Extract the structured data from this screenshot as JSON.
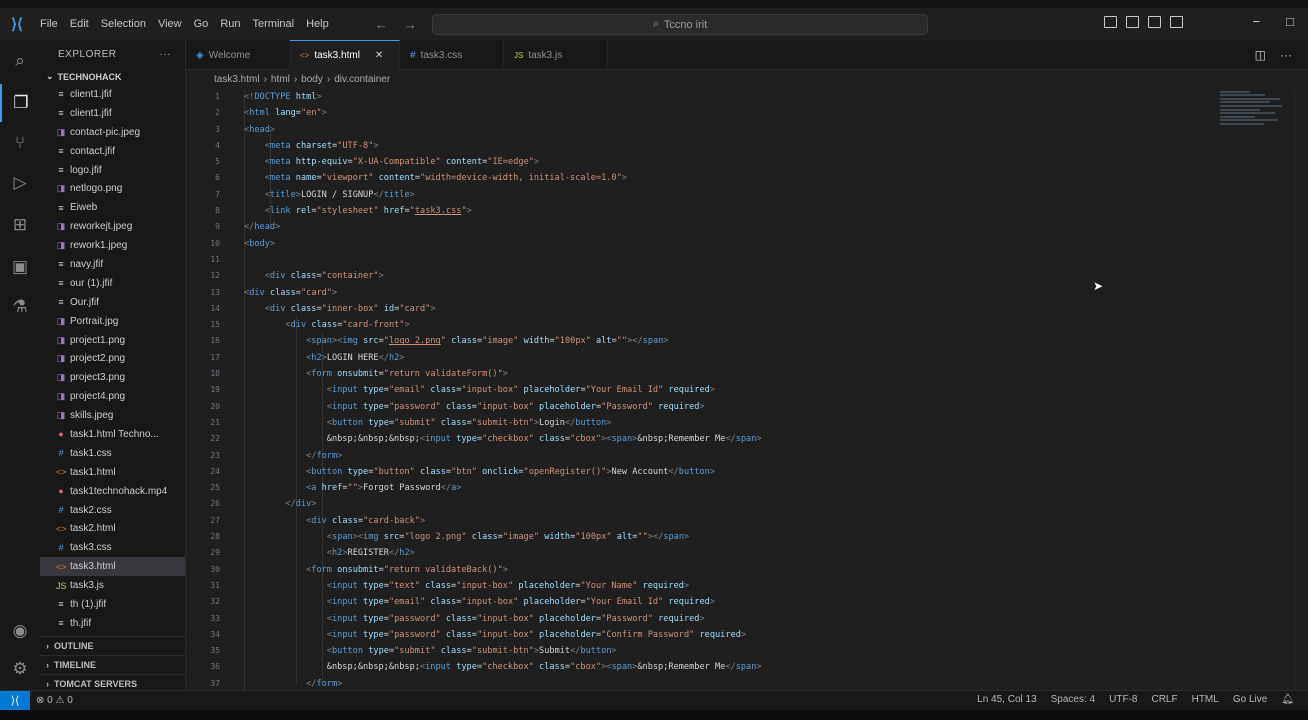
{
  "colors": {
    "accent": "#3b9bea",
    "tag": "#569cd6",
    "attr": "#9cdcfe",
    "string": "#ce9178",
    "remote_bg": "#0078d4"
  },
  "titlebar": {
    "menu": [
      "File",
      "Edit",
      "Selection",
      "View",
      "Go",
      "Run",
      "Terminal",
      "Help"
    ],
    "command_center": "Tccno irit"
  },
  "activity": {
    "icons": [
      "files-icon",
      "search-icon",
      "source-control-icon",
      "run-debug-icon",
      "extensions-icon",
      "remote-explorer-icon",
      "testing-icon",
      "account-icon",
      "settings-gear-icon"
    ]
  },
  "sidebar": {
    "title": "EXPLORER",
    "folder": "TECHNOHACK",
    "files": [
      {
        "name": "client1.jfif",
        "icon": "≡",
        "color": "#cccccc"
      },
      {
        "name": "client1.jfif",
        "icon": "≡",
        "color": "#cccccc"
      },
      {
        "name": "contact-pic.jpeg",
        "icon": "◨",
        "color": "#a074c4"
      },
      {
        "name": "contact.jfif",
        "icon": "≡",
        "color": "#cccccc"
      },
      {
        "name": "logo.jfif",
        "icon": "≡",
        "color": "#cccccc"
      },
      {
        "name": "netlogo.png",
        "icon": "◨",
        "color": "#a074c4"
      },
      {
        "name": "Eiweb",
        "icon": "≡",
        "color": "#cccccc"
      },
      {
        "name": "reworkejt.jpeg",
        "icon": "◨",
        "color": "#a074c4"
      },
      {
        "name": "rework1.jpeg",
        "icon": "◨",
        "color": "#a074c4"
      },
      {
        "name": "navy.jfif",
        "icon": "≡",
        "color": "#cccccc"
      },
      {
        "name": "our (1).jfif",
        "icon": "≡",
        "color": "#cccccc"
      },
      {
        "name": "Our.jfif",
        "icon": "≡",
        "color": "#cccccc"
      },
      {
        "name": "Portrait.jpg",
        "icon": "◨",
        "color": "#a074c4"
      },
      {
        "name": "project1.png",
        "icon": "◨",
        "color": "#a074c4"
      },
      {
        "name": "project2.png",
        "icon": "◨",
        "color": "#a074c4"
      },
      {
        "name": "project3.png",
        "icon": "◨",
        "color": "#a074c4"
      },
      {
        "name": "project4.png",
        "icon": "◨",
        "color": "#a074c4"
      },
      {
        "name": "skills.jpeg",
        "icon": "◨",
        "color": "#a074c4"
      },
      {
        "name": "task1.html   Techno...",
        "icon": "●",
        "color": "#e05d6f"
      },
      {
        "name": "task1.css",
        "icon": "#",
        "color": "#42a5f5"
      },
      {
        "name": "task1.html",
        "icon": "<>",
        "color": "#e37933"
      },
      {
        "name": "task1technohack.mp4",
        "icon": "●",
        "color": "#e05d6f"
      },
      {
        "name": "task2.css",
        "icon": "#",
        "color": "#42a5f5"
      },
      {
        "name": "task2.html",
        "icon": "<>",
        "color": "#e37933"
      },
      {
        "name": "task3.css",
        "icon": "#",
        "color": "#42a5f5"
      },
      {
        "name": "task3.html",
        "icon": "<>",
        "color": "#e37933",
        "selected": true
      },
      {
        "name": "task3.js",
        "icon": "JS",
        "color": "#cbcb41"
      },
      {
        "name": "th (1).jfif",
        "icon": "≡",
        "color": "#cccccc"
      },
      {
        "name": "th.jfif",
        "icon": "≡",
        "color": "#cccccc"
      }
    ],
    "sections": [
      "OUTLINE",
      "TIMELINE",
      "TOMCAT SERVERS"
    ]
  },
  "tabs": [
    {
      "label": "Welcome",
      "icon": "◈",
      "active": false
    },
    {
      "label": "task3.html",
      "icon": "<>",
      "active": true
    },
    {
      "label": "task3.css",
      "icon": "#",
      "active": false
    },
    {
      "label": "task3.js",
      "icon": "JS",
      "active": false
    }
  ],
  "breadcrumb": [
    "task3.html",
    "html",
    "body",
    "div.container"
  ],
  "editor": {
    "line_numbers": [
      "1",
      "2",
      "3",
      "4",
      "5",
      "6",
      "7",
      "8",
      "9",
      "10",
      "11",
      "12",
      "13",
      "14",
      "15",
      "16",
      "17",
      "18",
      "19",
      "20",
      "21",
      "22",
      "23",
      "24",
      "25",
      "26",
      "27",
      "28",
      "29",
      "30",
      "31",
      "32",
      "33",
      "34",
      "35",
      "36",
      "37"
    ]
  },
  "statusbar": {
    "problems": "⊗ 0 ⚠ 0",
    "position": "Ln 45, Col 13",
    "spaces": "Spaces: 4",
    "encoding": "UTF-8",
    "eol": "CRLF",
    "language": "HTML",
    "golive": "Go Live"
  }
}
